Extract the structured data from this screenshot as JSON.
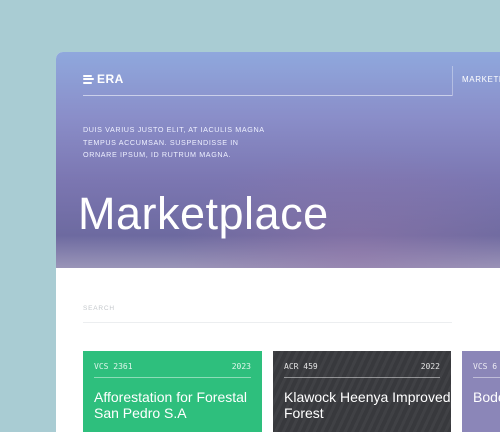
{
  "logo": {
    "text": "ERA",
    "icon": "era-logo-mark-icon"
  },
  "nav": {
    "marketplace_label": "MARKETPL"
  },
  "hero": {
    "description": "DUIS VARIUS JUSTO ELIT, AT IACULIS MAGNA TEMPUS ACCUMSAN. SUSPENDISSE IN ORNARE IPSUM, ID RUTRUM MAGNA.",
    "title": "Marketplace"
  },
  "search": {
    "label": "SEARCH"
  },
  "cards": [
    {
      "code": "VCS 2361",
      "year": "2023",
      "title": "Afforestation for Forestal San Pedro S.A",
      "color": "#2ebf7d"
    },
    {
      "code": "ACR 459",
      "year": "2022",
      "title": "Klawock Heenya Improved Forest",
      "color": "#3a3b3f"
    },
    {
      "code": "VCS 6",
      "year": "",
      "title": "Bode Prese",
      "color": "#8b86b8"
    }
  ],
  "colors": {
    "background": "#a9ccd3",
    "hero_gradient_top": "#8fa8dd",
    "hero_gradient_bottom": "#6d6aa0"
  }
}
